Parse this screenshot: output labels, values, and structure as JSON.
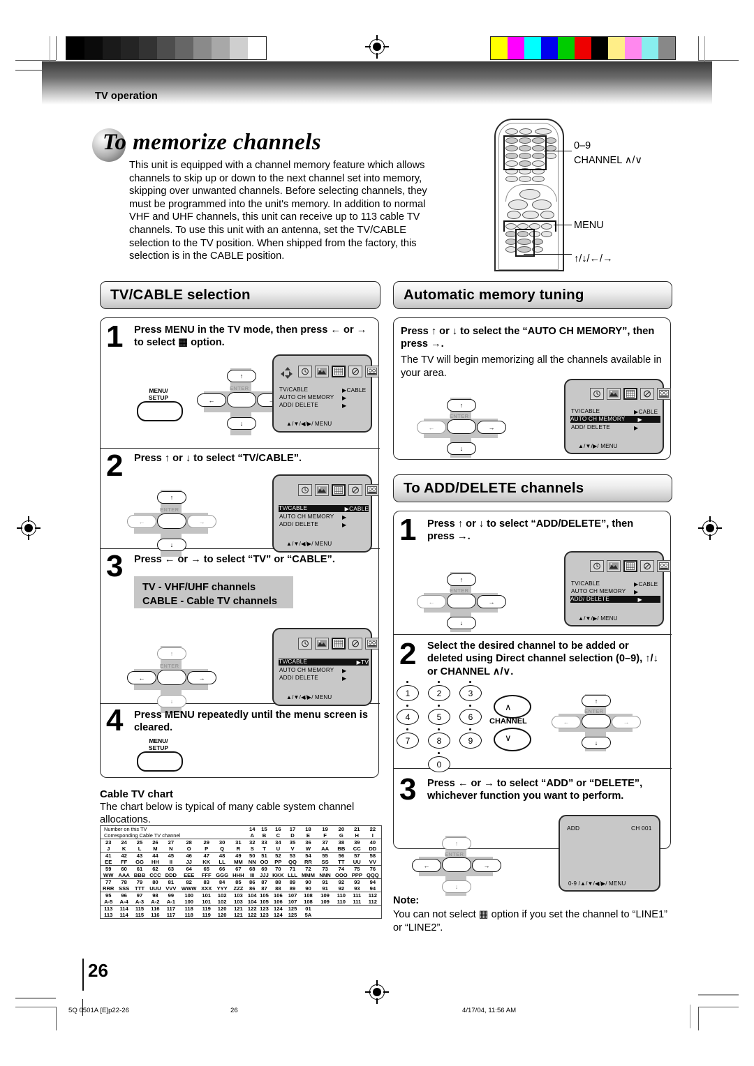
{
  "header": {
    "section_label": "TV operation"
  },
  "title": {
    "text": "To memorize channels"
  },
  "intro": {
    "text": "This unit is equipped with a channel memory feature which allows channels to skip up or down to the next channel set into memory, skipping over unwanted channels. Before selecting channels, they must be programmed into the unit's memory. In addition to normal VHF and UHF channels, this unit can receive up to 113 cable TV channels. To use this unit with an antenna, set the TV/CABLE selection to the TV position. When shipped from the factory, this selection is in the CABLE position."
  },
  "remote": {
    "label_numeric": "0–9",
    "label_channel": "CHANNEL ∧/∨",
    "label_menu": "MENU",
    "label_arrows": "↑/↓/←/→"
  },
  "osd": {
    "row1": "TV/CABLE",
    "row2": "AUTO  CH  MEMORY",
    "row3": "ADD/ DELETE",
    "value_cable": "▶CABLE",
    "value_tv": "▶TV",
    "arrow": "▶",
    "footer_full": "▲/▼/◀/▶/ MENU",
    "footer_short": "▲/▼/▶/ MENU",
    "footer_add": "0-9 /▲/▼/◀/▶/ MENU",
    "add_label": "ADD",
    "add_channel": "CH 001"
  },
  "buttons": {
    "menu_setup_line1": "MENU/",
    "menu_setup_line2": "SETUP",
    "enter": "ENTER",
    "left": "←",
    "right": "→",
    "up": "↑",
    "down": "↓",
    "channel": "CHANNEL"
  },
  "sections": {
    "tv_cable": {
      "heading": "TV/CABLE selection",
      "steps": [
        {
          "num": "1",
          "text": "Press MENU in the TV mode, then press ← or → to select ▦ option."
        },
        {
          "num": "2",
          "text": "Press ↑ or ↓ to select “TV/CABLE”."
        },
        {
          "num": "3",
          "text": "Press ← or → to select “TV” or “CABLE”."
        },
        {
          "num": "4",
          "text": "Press MENU repeatedly until the menu screen is cleared."
        }
      ],
      "note_box_line1": "TV - VHF/UHF channels",
      "note_box_line2": "CABLE - Cable TV channels"
    },
    "auto_memory": {
      "heading": "Automatic memory tuning",
      "step_bold": "Press ↑ or ↓ to select the “AUTO CH MEMORY”, then press →.",
      "step_body": "The TV will begin memorizing all the channels available in your area."
    },
    "add_delete": {
      "heading": "To ADD/DELETE channels",
      "steps": [
        {
          "num": "1",
          "text": "Press ↑ or ↓ to select “ADD/DELETE”, then press →."
        },
        {
          "num": "2",
          "text": "Select the desired channel to be added or deleted using Direct channel selection (0–9), ↑/↓ or CHANNEL ∧/∨."
        },
        {
          "num": "3",
          "text": "Press ← or → to select “ADD” or “DELETE”, whichever function you want to perform."
        }
      ]
    },
    "note": {
      "title": "Note:",
      "text": "You can not select ▦ option if you set the channel to “LINE1” or “LINE2”."
    }
  },
  "keypad": {
    "keys": [
      "1",
      "2",
      "3",
      "4",
      "5",
      "6",
      "7",
      "8",
      "9",
      "0"
    ]
  },
  "cable_chart": {
    "title": "Cable TV chart",
    "subtitle": "The chart below is typical of many cable system channel allocations.",
    "header_line1": "Number on this TV",
    "header_line2": "Corresponding Cable TV channel",
    "rows": [
      {
        "top": [
          "",
          "",
          "",
          "",
          "",
          "",
          "",
          "",
          "",
          "14",
          "15",
          "16",
          "17",
          "18",
          "19",
          "20",
          "21",
          "22"
        ],
        "bottom": [
          "",
          "",
          "",
          "",
          "",
          "",
          "",
          "",
          "",
          "A",
          "B",
          "C",
          "D",
          "E",
          "F",
          "G",
          "H",
          "I"
        ]
      },
      {
        "top": [
          "23",
          "24",
          "25",
          "26",
          "27",
          "28",
          "29",
          "30",
          "31",
          "32",
          "33",
          "34",
          "35",
          "36",
          "37",
          "38",
          "39",
          "40"
        ],
        "bottom": [
          "J",
          "K",
          "L",
          "M",
          "N",
          "O",
          "P",
          "Q",
          "R",
          "S",
          "T",
          "U",
          "V",
          "W",
          "AA",
          "BB",
          "CC",
          "DD"
        ]
      },
      {
        "top": [
          "41",
          "42",
          "43",
          "44",
          "45",
          "46",
          "47",
          "48",
          "49",
          "50",
          "51",
          "52",
          "53",
          "54",
          "55",
          "56",
          "57",
          "58"
        ],
        "bottom": [
          "EE",
          "FF",
          "GG",
          "HH",
          "II",
          "JJ",
          "KK",
          "LL",
          "MM",
          "NN",
          "OO",
          "PP",
          "QQ",
          "RR",
          "SS",
          "TT",
          "UU",
          "VV"
        ]
      },
      {
        "top": [
          "59",
          "60",
          "61",
          "62",
          "63",
          "64",
          "65",
          "66",
          "67",
          "68",
          "69",
          "70",
          "71",
          "72",
          "73",
          "74",
          "75",
          "76"
        ],
        "bottom": [
          "WW",
          "AAA",
          "BBB",
          "CCC",
          "DDD",
          "EEE",
          "FFF",
          "GGG",
          "HHH",
          "III",
          "JJJ",
          "KKK",
          "LLL",
          "MMM",
          "NNN",
          "OOO",
          "PPP",
          "QQQ"
        ]
      },
      {
        "top": [
          "77",
          "78",
          "79",
          "80",
          "81",
          "82",
          "83",
          "84",
          "85",
          "86",
          "87",
          "88",
          "89",
          "90",
          "91",
          "92",
          "93",
          "94"
        ],
        "bottom": [
          "RRR",
          "SSS",
          "TTT",
          "UUU",
          "VVV",
          "WWW",
          "XXX",
          "YYY",
          "ZZZ",
          "86",
          "87",
          "88",
          "89",
          "90",
          "91",
          "92",
          "93",
          "94"
        ]
      },
      {
        "top": [
          "95",
          "96",
          "97",
          "98",
          "99",
          "100",
          "101",
          "102",
          "103",
          "104",
          "105",
          "106",
          "107",
          "108",
          "109",
          "110",
          "111",
          "112"
        ],
        "bottom": [
          "A-5",
          "A-4",
          "A-3",
          "A-2",
          "A-1",
          "100",
          "101",
          "102",
          "103",
          "104",
          "105",
          "106",
          "107",
          "108",
          "109",
          "110",
          "111",
          "112"
        ]
      },
      {
        "top": [
          "113",
          "114",
          "115",
          "116",
          "117",
          "118",
          "119",
          "120",
          "121",
          "122",
          "123",
          "124",
          "125",
          "01",
          "",
          "",
          "",
          ""
        ],
        "bottom": [
          "113",
          "114",
          "115",
          "116",
          "117",
          "118",
          "119",
          "120",
          "121",
          "122",
          "123",
          "124",
          "125",
          "5A",
          "",
          "",
          "",
          ""
        ]
      }
    ]
  },
  "footer": {
    "page_number": "26",
    "file_ref": "5Q  0501A [E]p22-26",
    "center_page": "26",
    "timestamp": "4/17/04, 11:56 AM"
  },
  "colors": {
    "gray_bar": [
      "#000000",
      "#0b0b0b",
      "#1a1a1a",
      "#242424",
      "#333333",
      "#4d4d4d",
      "#666666",
      "#8a8a8a",
      "#a8a8a8",
      "#cfcfcf",
      "#ffffff"
    ],
    "color_bar": [
      "#ffff00",
      "#ff00ff",
      "#00ffff",
      "#0000ee",
      "#00cc00",
      "#ee0000",
      "#000000",
      "#ffee88",
      "#ff88ee",
      "#88eeee",
      "#888888"
    ],
    "osd_bg": "#c8c8c8",
    "highlight": "#111111"
  }
}
